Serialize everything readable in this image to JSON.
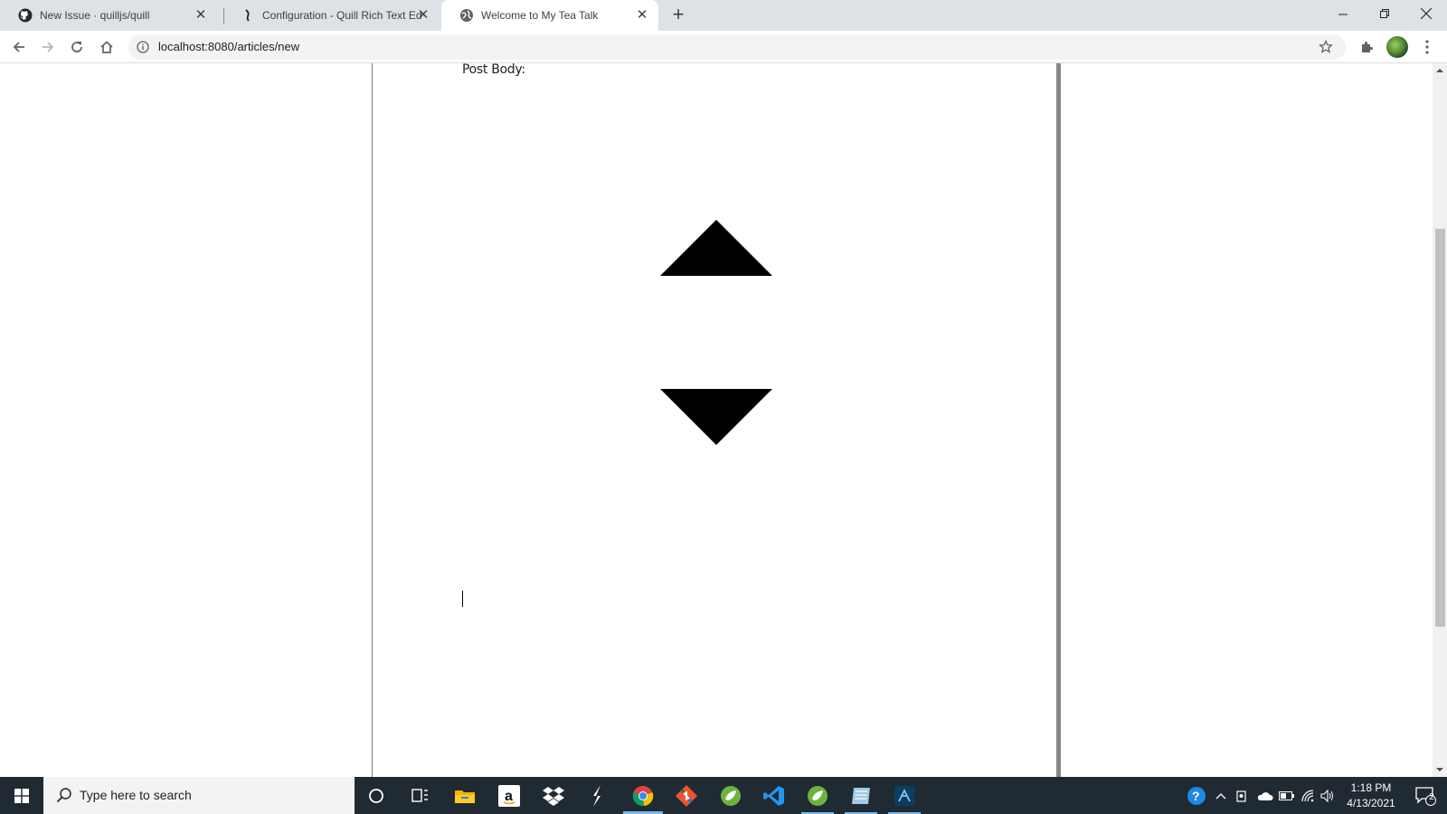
{
  "browser": {
    "tabs": [
      {
        "title": "New Issue · quilljs/quill",
        "icon": "github-icon",
        "active": false
      },
      {
        "title": "Configuration - Quill Rich Text Ed",
        "icon": "quill-icon",
        "active": false
      },
      {
        "title": "Welcome to My Tea Talk",
        "icon": "globe-icon",
        "active": true
      }
    ],
    "new_tab_label": "+",
    "url": "localhost:8080/articles/new"
  },
  "page": {
    "post_body_label": "Post Body:"
  },
  "taskbar": {
    "search_placeholder": "Type here to search",
    "pinned": [
      "cortana-icon",
      "task-view-icon",
      "file-explorer-icon",
      "amazon-icon",
      "dropbox-icon",
      "sublime-text-icon",
      "chrome-icon",
      "git-kraken-icon",
      "spring-tool-suite-icon",
      "vscode-icon",
      "spring-tool-suite-2-icon",
      "notepad-icon",
      "android-studio-icon"
    ],
    "clock": {
      "time": "1:18 PM",
      "date": "4/13/2021"
    },
    "notification_count": "2"
  },
  "colors": {
    "tabstrip_bg": "#dee1e6",
    "taskbar_bg": "#202a33",
    "accent": "#76b9ed"
  }
}
